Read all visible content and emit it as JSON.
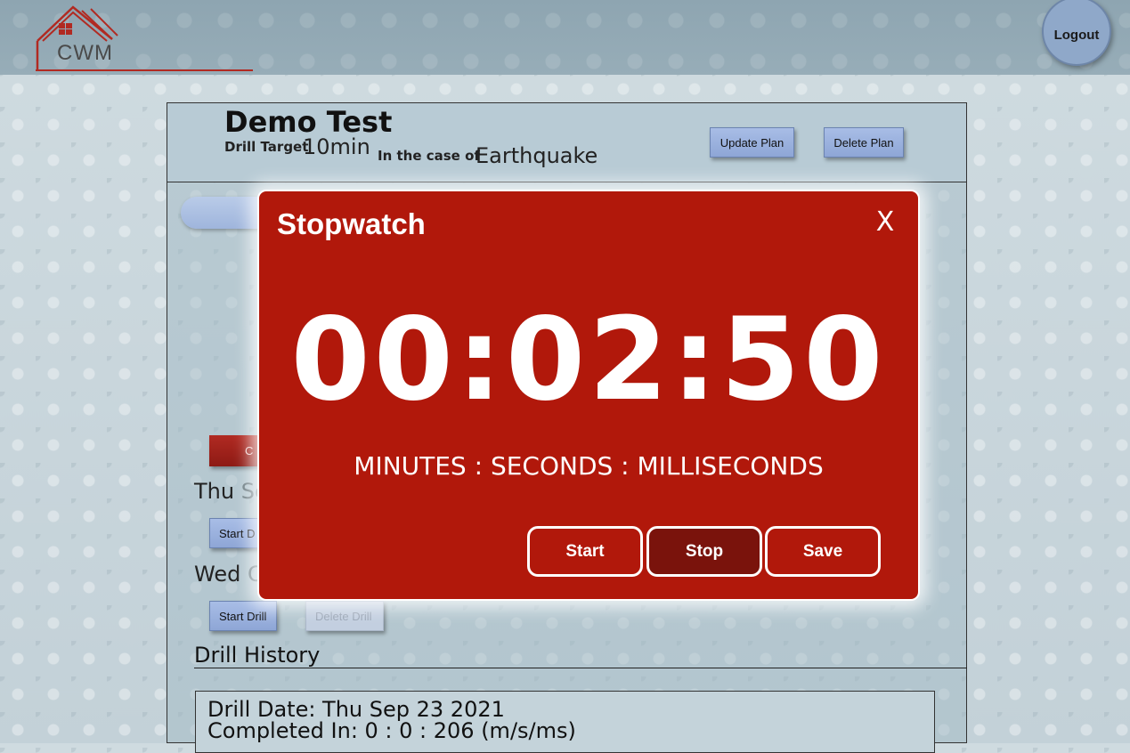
{
  "header": {
    "logo_text": "CWM",
    "logout_label": "Logout"
  },
  "plan": {
    "title": "Demo Test",
    "target_label": "Drill Target",
    "target_value": "10min",
    "case_label": "In the case of",
    "case_value": "Earthquake",
    "update_label": "Update Plan",
    "delete_label": "Delete Plan"
  },
  "background": {
    "red_button_partial": "C",
    "drills": [
      {
        "day_visible": "Thu",
        "rest_visible": "Se",
        "start_label": "Start D"
      },
      {
        "day_visible": "Wed",
        "rest_visible": "C",
        "start_label": "Start Drill",
        "delete_label": "Delete Drill"
      }
    ]
  },
  "history": {
    "title": "Drill History",
    "entries": [
      {
        "date_line": "Drill Date: Thu Sep 23 2021",
        "completed_line": "Completed In: 0 : 0 : 206 (m/s/ms)"
      }
    ]
  },
  "stopwatch": {
    "title": "Stopwatch",
    "close_glyph": "X",
    "time": "00:02:50",
    "caption": "MINUTES : SECONDS : MILLISECONDS",
    "start_label": "Start",
    "stop_label": "Stop",
    "save_label": "Save"
  },
  "colors": {
    "modal_bg": "#b1180b",
    "active_button": "#7a130c",
    "accent_blue": "#8ea6d6"
  }
}
